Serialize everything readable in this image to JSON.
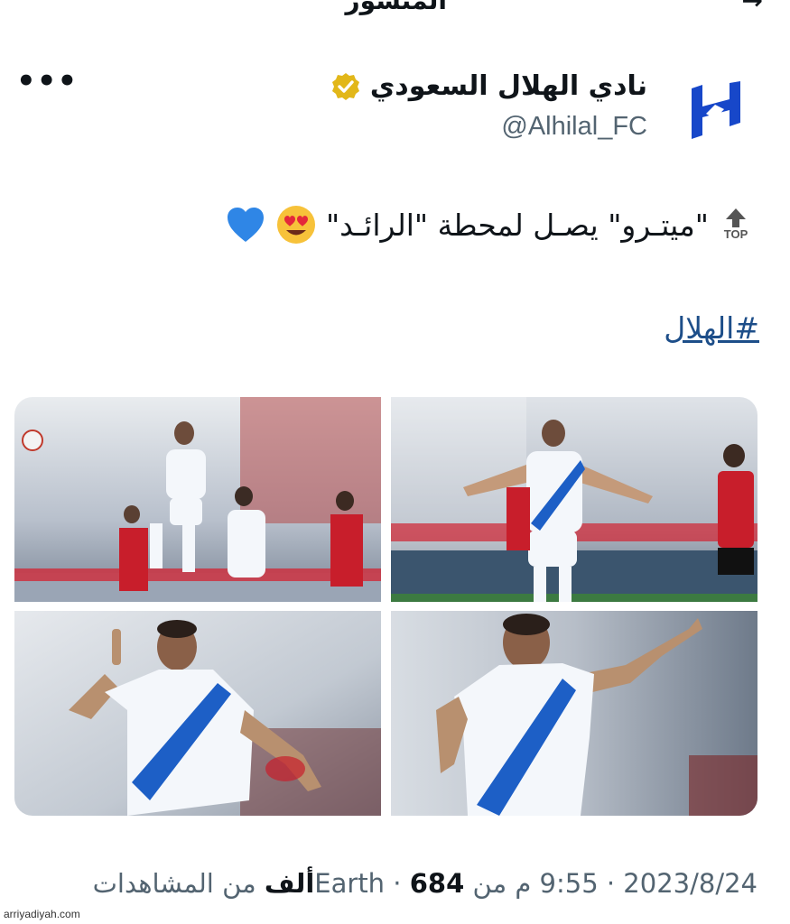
{
  "topbar": {
    "title_partial": "المنشور",
    "back_icon": "arrow-right-icon"
  },
  "author": {
    "display_name": "نادي الهلال السعودي",
    "handle": "@Alhilal_FC",
    "verified_badge_color": "#e2b719",
    "logo_color": "#1747c9"
  },
  "more_label": "•••",
  "tweet": {
    "top_icon_label": "TOP",
    "text": "\"ميتـرو\" يصـل لمحطة \"الرائـد\"",
    "emojis": [
      "heart-eyes-emoji",
      "blue-heart-emoji"
    ],
    "hashtag": "#الهلال"
  },
  "media": [
    {
      "alt": "photo-1"
    },
    {
      "alt": "photo-2"
    },
    {
      "alt": "photo-3"
    },
    {
      "alt": "photo-4"
    }
  ],
  "meta": {
    "date": "2023/8/24",
    "time": "9:55 م",
    "source": "من Earth",
    "views_count": "684",
    "views_unit": "ألف",
    "views_label": "من المشاهدات",
    "separator": "·"
  },
  "watermark": "arriyadiyah.com"
}
